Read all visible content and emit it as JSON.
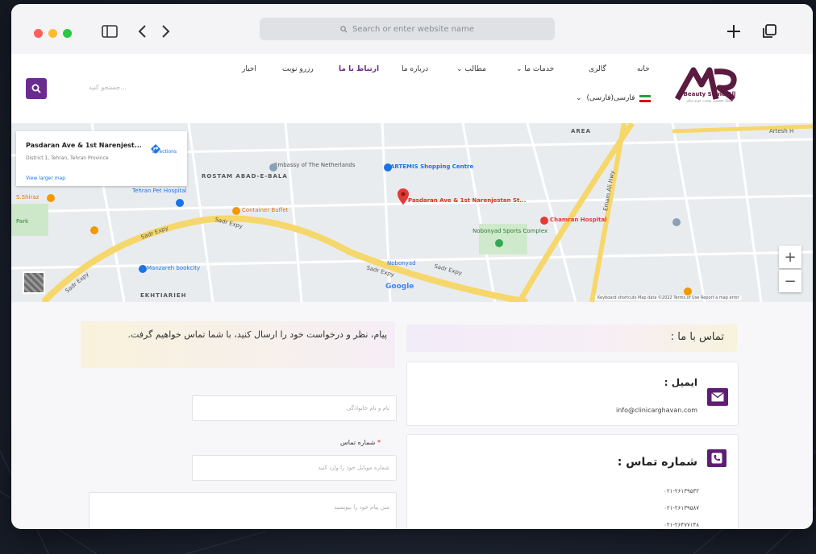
{
  "browser": {
    "address_placeholder": "Search or enter website name",
    "traffic_lights": {
      "close": "#ff5f57",
      "minimize": "#febc2e",
      "maximize": "#28c840"
    }
  },
  "header": {
    "logo_text": "Beauty Shine All",
    "logo_subtext": "کلینیک تخصصی پوست، مو و زیبایی",
    "nav": [
      "خانه",
      "گالری",
      "خدمات ما",
      "مطالب",
      "درباره ما",
      "ارتباط با ما",
      "رزرو نوبت",
      "اخبار"
    ],
    "active_nav": "ارتباط با ما",
    "language": "فارسی(فارسی)",
    "search_placeholder": "جستجو کنید...",
    "brand_color": "#6b2c8f"
  },
  "map": {
    "card": {
      "title": "Pasdaran Ave & 1st Narenjest...",
      "address": "District 1, Tehran, Tehran Province",
      "larger_map": "View larger map",
      "directions": "Directions"
    },
    "pin_label": "Pasdaran Ave & 1st Narenjestan St...",
    "labels": {
      "rostam": "ROSTAM ABAD-E-BALA",
      "artemis": "ARTEMIS Shopping Centre",
      "embassy": "Embassy of The Netherlands",
      "chamran": "Chamran Hospital",
      "nobonyad": "Nobonyad Sports Complex",
      "pet": "Tehran Pet Hospital",
      "manzareh": "Manzareh bookcity",
      "container": "Container Buffet",
      "sadr1": "Sadr Expy",
      "sadr2": "Sadr Expy",
      "sadr3": "Sadr Expy",
      "sadr4": "Sadr Expy",
      "sadr5": "Sadr Expy",
      "shiraz": "S.Shiraz",
      "park": "Park",
      "ekhtiarieh": "EKHTIARIEH",
      "area": "AREA",
      "artesh": "Artesh H",
      "emam": "Emam Ali Hwy",
      "nobonyad_sq": "Nobonyad",
      "google": "Google",
      "footer": "Keyboard shortcuts   Map data ©2022   Terms of Use   Report a map error"
    },
    "zoom_in": "+",
    "zoom_out": "−"
  },
  "contact": {
    "heading": "تماس با ما :",
    "email_label": "ایمیل :",
    "email": "info@clinicarghavan.com",
    "phone_label": "شماره تماس :",
    "phones": [
      "۰۲۱-۲۶۱۳۹۵۳۲",
      "۰۲۱-۲۶۱۳۹۵۸۷",
      "۰۲۱-۲۶۴۷۷۱۴۸"
    ]
  },
  "form": {
    "message": "پیام، نظر و درخواست خود را ارسال کنید، با شما تماس خواهیم گرفت.",
    "name_placeholder": "نام و نام خانوادگی",
    "phone_label": "شماره تماس",
    "phone_placeholder": "شماره موبایل خود را وارد کنید",
    "message_placeholder": "متن پیام خود را بنویسید"
  }
}
